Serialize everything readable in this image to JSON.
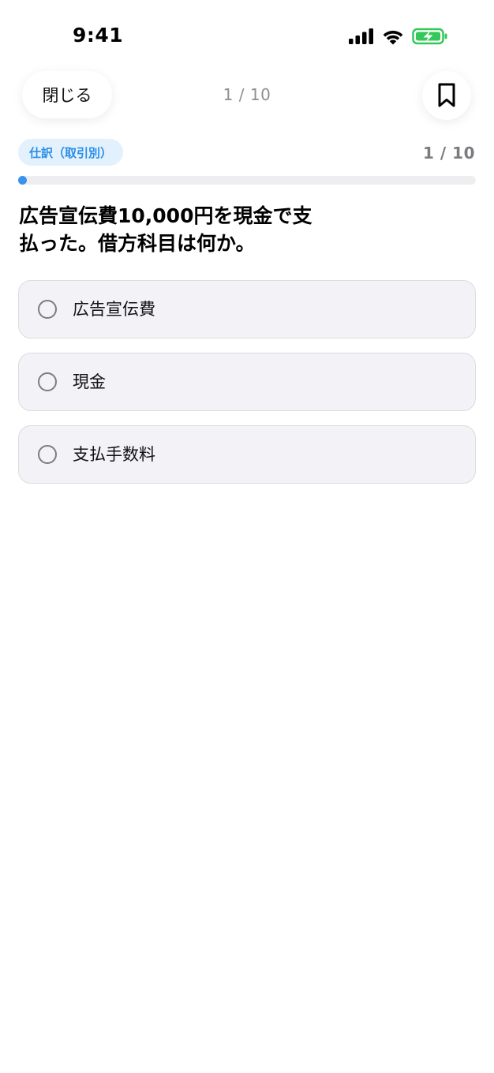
{
  "status_bar": {
    "time": "9:41",
    "icons": [
      "cellular-signal-icon",
      "wifi-icon",
      "battery-charging-icon"
    ],
    "battery_color": "#34c759"
  },
  "nav": {
    "close_label": "閉じる",
    "progress_text": "1 / 10",
    "bookmark_icon": "bookmark-icon"
  },
  "quiz": {
    "category": "仕訳（取引別）",
    "counter": "1 / 10",
    "progress_fraction": 0.1,
    "accent_color": "#3a92ec",
    "question": "広告宣伝費10,000円を現金で支払った。借方科目は何か。",
    "options": [
      {
        "label": "広告宣伝費",
        "selected": false
      },
      {
        "label": "現金",
        "selected": false
      },
      {
        "label": "支払手数料",
        "selected": false
      }
    ]
  }
}
